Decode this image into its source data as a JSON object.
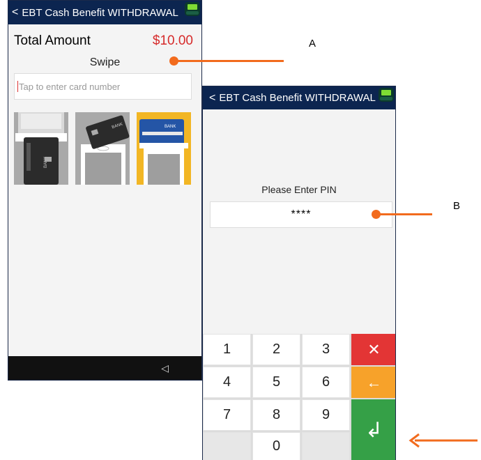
{
  "screen_a": {
    "title": "EBT Cash Benefit WITHDRAWAL",
    "back_glyph": "<",
    "total_label": "Total Amount",
    "total_amount": "$10.00",
    "entry_mode": "Swipe",
    "card_input_placeholder": "Tap to enter card number",
    "payment_methods": [
      "swipe-card-icon",
      "tap-card-icon",
      "insert-card-icon"
    ],
    "nav_back_glyph": "◁"
  },
  "screen_b": {
    "title": "EBT Cash Benefit WITHDRAWAL",
    "back_glyph": "<",
    "pin_label": "Please Enter PIN",
    "pin_value": "****",
    "keys": [
      "1",
      "2",
      "3",
      "4",
      "5",
      "6",
      "7",
      "8",
      "9",
      "0"
    ],
    "cancel_glyph": "✕",
    "backspace_glyph": "←",
    "enter_glyph": "↲"
  },
  "annotations": {
    "label_a": "A",
    "label_b": "B"
  },
  "colors": {
    "title_bar": "#0c2550",
    "amount": "#d62b2b",
    "cancel": "#e33535",
    "backspace": "#f7a22a",
    "enter": "#35a047",
    "callout": "#f26b1d"
  }
}
